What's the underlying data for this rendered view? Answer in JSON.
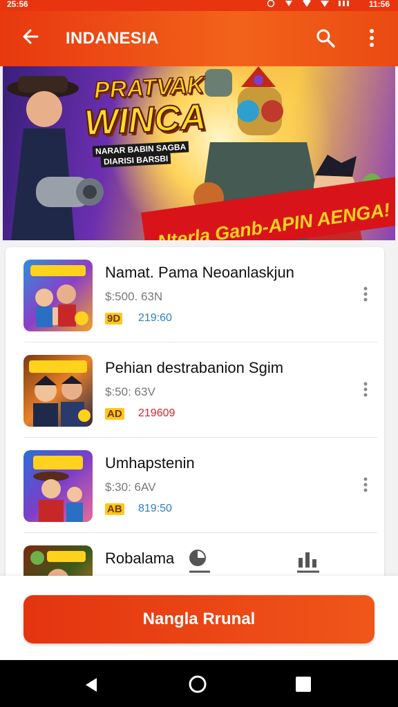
{
  "status_bar": {
    "time_left": "25:56",
    "time_right": "11:56"
  },
  "app_bar": {
    "title": "INDANESIA",
    "back_icon": "arrow-left-icon",
    "search_icon": "search-icon",
    "more_icon": "more-vert-icon"
  },
  "banner": {
    "title_line1": "PRATVAK",
    "title_line2": "WINCA",
    "subtitle_line1": "NARAR BABIN SAGBA",
    "subtitle_line2": "DIARISI BARSBI",
    "ribbon_text": "Nterla Ganb-APIN AENGA!"
  },
  "list": {
    "items": [
      {
        "name": "Namat. Pama Neoanlaskjun",
        "price": "$:500. 63N",
        "badge": "9D",
        "count": "219:60",
        "count_color": "#2a7fc4"
      },
      {
        "name": "Pehian destrabanion Sgim",
        "price": "$:50: 63V",
        "badge": "AD",
        "count": "219609",
        "count_color": "#d6222a"
      },
      {
        "name": "Umhapstenin",
        "price": "$:30: 6AV",
        "badge": "AB",
        "count": "819:50",
        "count_color": "#2a7fc4"
      },
      {
        "name": "Robalama",
        "price": "",
        "badge": "",
        "count": "",
        "count_color": "#2a7fc4"
      }
    ]
  },
  "cta": {
    "label": "Nangla Rrunal"
  }
}
